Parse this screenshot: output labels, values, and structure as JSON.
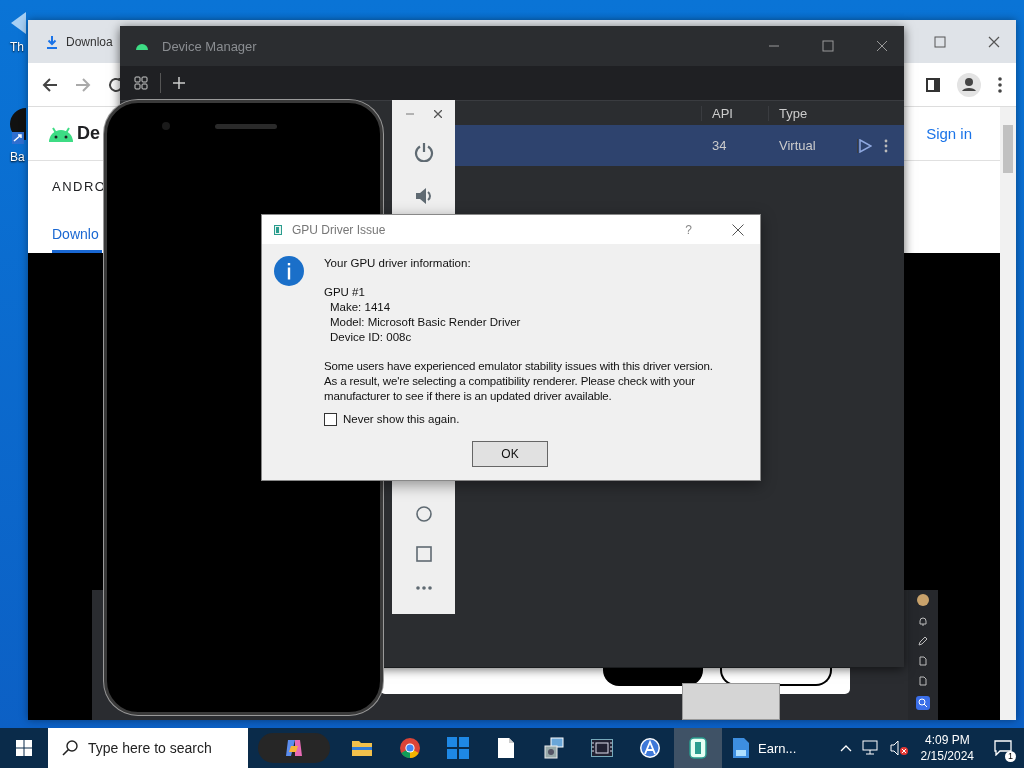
{
  "desktop": {
    "icons": [
      {
        "label": "Th"
      },
      {
        "label": "Ba"
      }
    ]
  },
  "browser": {
    "tab_title": "Downloa",
    "logo_text": "De",
    "sign_in": "Sign in",
    "section_label": "ANDRO",
    "nav_tab": {
      "label": "Downlo",
      "selected": true
    }
  },
  "device_manager": {
    "title": "Device Manager",
    "columns": [
      "API",
      "Type"
    ],
    "rows": [
      {
        "api": "34",
        "type": "Virtual",
        "selected": true
      }
    ]
  },
  "dialog": {
    "title": "GPU Driver Issue",
    "help": "?",
    "heading": "Your GPU driver information:",
    "gpu_name": "GPU #1",
    "gpu_details": [
      "Make: 1414",
      "Model: Microsoft Basic Render Driver",
      "Device ID: 008c"
    ],
    "message": "Some users have experienced emulator stability issues with this driver version.\nAs a result, we're selecting a compatibility renderer.  Please check with your\nmanufacturer to see if there is an updated driver available.",
    "checkbox": {
      "label": "Never show this again.",
      "checked": false
    },
    "ok_button": "OK"
  },
  "taskbar": {
    "search_placeholder": "Type here to search",
    "apps": [
      {
        "kind": "explorer",
        "active": false
      },
      {
        "kind": "chrome",
        "active": false
      },
      {
        "kind": "tiles",
        "active": false
      },
      {
        "kind": "document",
        "active": false
      },
      {
        "kind": "installer",
        "active": false
      },
      {
        "kind": "film",
        "active": false
      },
      {
        "kind": "studio",
        "active": false
      },
      {
        "kind": "emulator",
        "active": true
      },
      {
        "kind": "word",
        "active": false,
        "label": "Earn..."
      }
    ],
    "time": "4:09 PM",
    "date": "2/15/2024",
    "notification_count": "1"
  }
}
